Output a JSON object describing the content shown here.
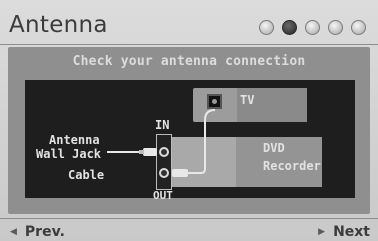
{
  "header": {
    "title": "Antenna",
    "steps": [
      {
        "state": "pending"
      },
      {
        "state": "active"
      },
      {
        "state": "pending"
      },
      {
        "state": "pending"
      },
      {
        "state": "pending"
      }
    ]
  },
  "panel": {
    "subtitle": "Check your antenna connection"
  },
  "diagram": {
    "source_lines": [
      "Antenna",
      "Wall Jack",
      "Cable"
    ],
    "in_label": "IN",
    "out_label": "OUT",
    "tv_label": "TV",
    "recorder_lines": [
      "DVD",
      "Recorder"
    ]
  },
  "nav": {
    "prev_label": "Prev.",
    "next_label": "Next",
    "prev_icon": "triangle-left-icon",
    "next_icon": "triangle-right-icon"
  },
  "colors": {
    "background": "#cfcfcf",
    "panel": "#8f8f8f",
    "diagram_bg": "#1e1e1e",
    "active_step": "#3a3a3a"
  }
}
